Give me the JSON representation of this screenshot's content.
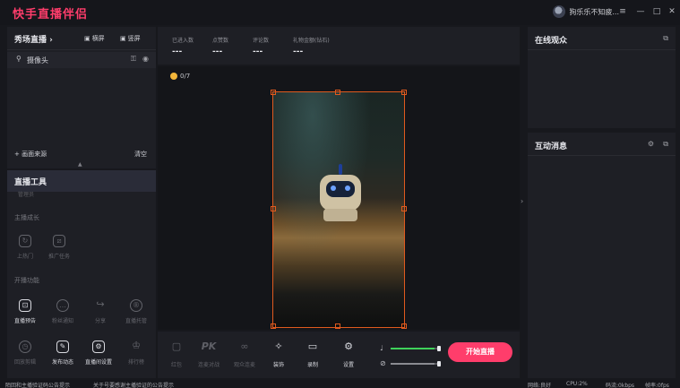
{
  "app": {
    "title": "快手直播伴侣"
  },
  "window": {
    "user_name": "狗乐乐不知疲...",
    "menu_icon": "menu-icon",
    "minimize": "—",
    "maximize": "□",
    "close": "✕"
  },
  "scene": {
    "title": "秀场直播",
    "chevron": "›",
    "btn_portrait": "横屏",
    "btn_landscape": "竖屏",
    "source_label": "摄像头",
    "add_source": "+ 画面来源",
    "clear": "清空"
  },
  "tools": {
    "title": "直播工具",
    "sub_cut": "管理员",
    "section_anchor": "主播成长",
    "section_common": "开播功能",
    "row1": [
      {
        "label": "上热门",
        "icon": "hot-icon"
      },
      {
        "label": "推广任务",
        "icon": "task-icon"
      }
    ],
    "row2": [
      {
        "label": "直播预告",
        "icon": "preview-icon"
      },
      {
        "label": "粉丝通知",
        "icon": "notify-icon"
      },
      {
        "label": "分享",
        "icon": "share-icon"
      },
      {
        "label": "直播托管",
        "icon": "hosting-icon"
      }
    ],
    "row3": [
      {
        "label": "回放剪辑",
        "icon": "replay-icon"
      },
      {
        "label": "发布动态",
        "icon": "edit-icon"
      },
      {
        "label": "直播间设置",
        "icon": "room-settings-icon"
      },
      {
        "label": "排行榜",
        "icon": "trophy-icon"
      }
    ]
  },
  "stats": [
    {
      "label": "已进入数",
      "value": "---"
    },
    {
      "label": "点赞数",
      "value": "---"
    },
    {
      "label": "评论数",
      "value": "---"
    },
    {
      "label": "礼物金额(钻石)",
      "value": "---"
    }
  ],
  "stage": {
    "likes": "0/7"
  },
  "toolbar": {
    "items": [
      {
        "label": "红包",
        "glyph": "▢",
        "lit": false
      },
      {
        "label": "连麦对战",
        "glyph": "PK",
        "lit": false
      },
      {
        "label": "观众连麦",
        "glyph": "∞",
        "lit": false
      },
      {
        "label": "装饰",
        "glyph": "✧",
        "lit": true
      },
      {
        "label": "录制",
        "glyph": "▭",
        "lit": true
      },
      {
        "label": "设置",
        "glyph": "⚙",
        "lit": true
      }
    ],
    "mic_level": 0.9,
    "speaker_level": 0.9,
    "start_label": "开始直播"
  },
  "right": {
    "viewers_title": "在线观众",
    "messages_title": "互动消息"
  },
  "status": {
    "notice1": "陌回和主播验证码公告提示",
    "notice2": "关于号要感谢主播验证的公告提示",
    "network": "网络:良好",
    "cpu": "CPU:2%",
    "upload": "码流:0kbps",
    "fps": "帧率:0fps"
  }
}
